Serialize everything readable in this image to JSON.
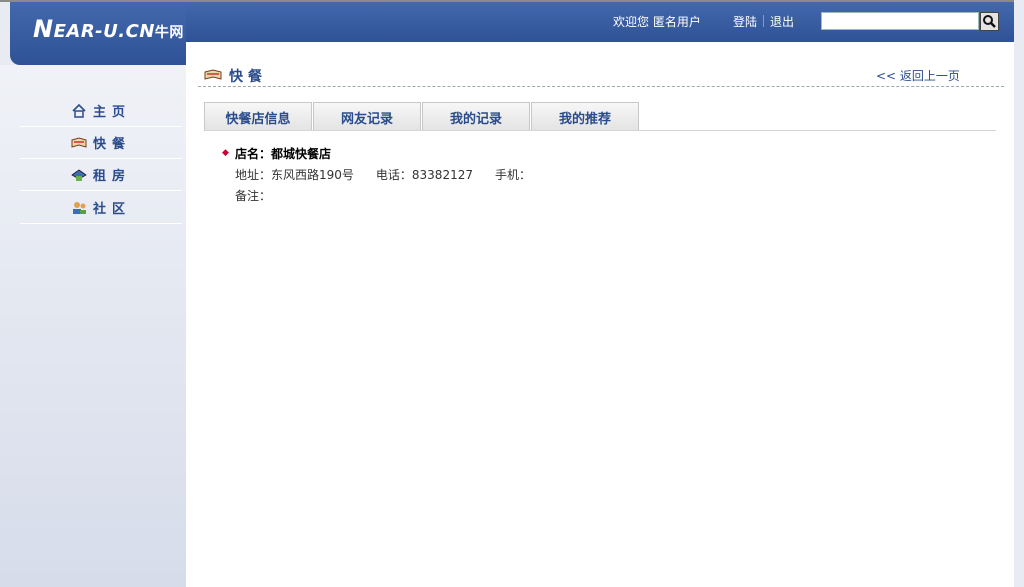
{
  "header": {
    "logo_main": "EAR-U.CN",
    "logo_n": "N",
    "logo_cn": "牛网",
    "welcome": "欢迎您 匿名用户",
    "login": "登陆",
    "logout": "退出",
    "search_value": ""
  },
  "sidebar": {
    "items": [
      {
        "label": "主页",
        "icon": "home-icon"
      },
      {
        "label": "快餐",
        "icon": "book-icon"
      },
      {
        "label": "租房",
        "icon": "house-icon"
      },
      {
        "label": "社区",
        "icon": "people-icon"
      }
    ]
  },
  "main": {
    "title": "快餐",
    "back": "<< 返回上一页",
    "tabs": [
      "快餐店信息",
      "网友记录",
      "我的记录",
      "我的推荐"
    ],
    "shop": {
      "name": "店名：都城快餐店",
      "address": "地址：东风西路190号",
      "phone": "电话：83382127",
      "mobile": "手机：",
      "note": "备注："
    }
  },
  "colors": {
    "header_blue": "#3a5ea3",
    "link_blue": "#2b4c8c"
  }
}
